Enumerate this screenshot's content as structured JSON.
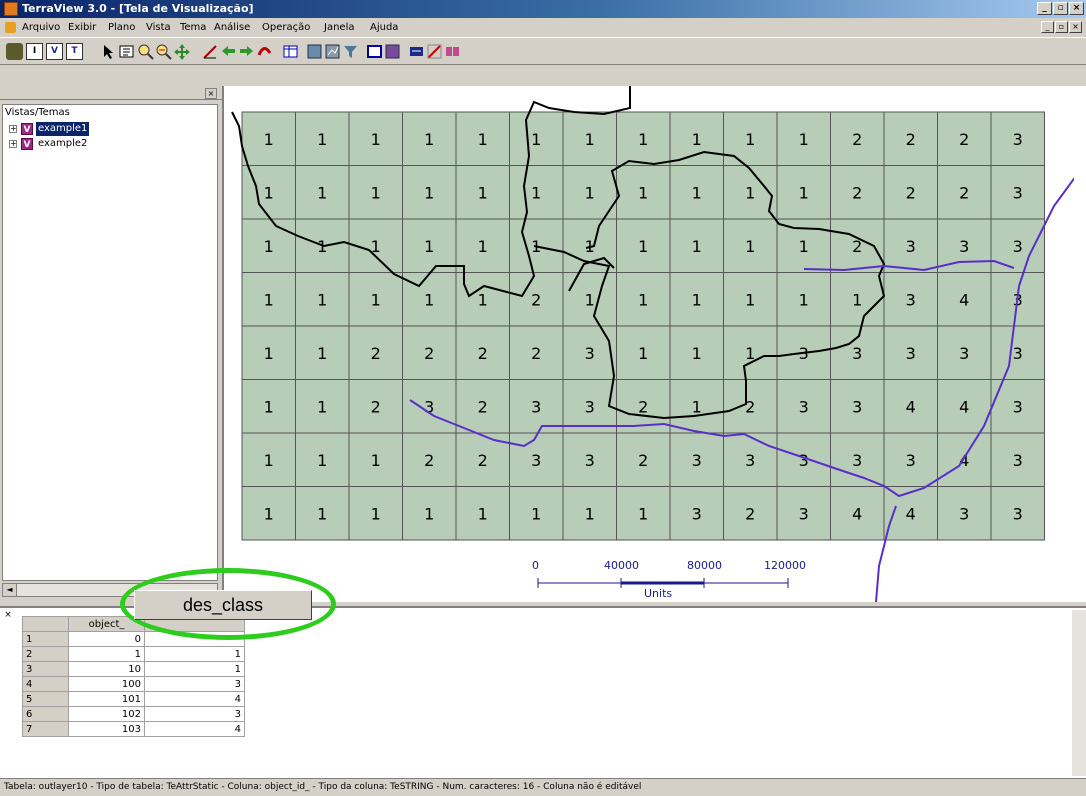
{
  "window": {
    "title": "TerraView 3.0 - [Tela de Visualização]",
    "min": "_",
    "max": "▫",
    "close": "×"
  },
  "menu": {
    "items": [
      "Arquivo",
      "Exibir",
      "Plano",
      "Vista",
      "Tema",
      "Análise",
      "Operação",
      "Janela",
      "Ajuda"
    ]
  },
  "toolbar": {
    "icons": [
      "database-icon",
      "I-layer-icon",
      "V-view-icon",
      "T-theme-icon",
      "pointer-icon",
      "info-icon",
      "zoom-in-icon",
      "zoom-out-icon",
      "pan-icon",
      "edit-icon",
      "back-icon",
      "forward-icon",
      "recompose-icon",
      "table-icon",
      "query-icon",
      "graph-icon",
      "filter-icon",
      "layout-icon",
      "print-icon",
      "legend-icon",
      "chart-icon",
      "export-icon"
    ],
    "letters": [
      "I",
      "V",
      "T"
    ]
  },
  "left_panel": {
    "close": "×",
    "tree_root": "Vistas/Temas",
    "items": [
      {
        "label": "example1",
        "badge": "V",
        "selected": true
      },
      {
        "label": "example2",
        "badge": "V",
        "selected": false
      }
    ],
    "scroll_left": "◄"
  },
  "map": {
    "rows": [
      [
        1,
        1,
        1,
        1,
        1,
        1,
        1,
        1,
        1,
        1,
        1,
        2,
        2,
        2,
        3
      ],
      [
        1,
        1,
        1,
        1,
        1,
        1,
        1,
        1,
        1,
        1,
        1,
        2,
        2,
        2,
        3
      ],
      [
        1,
        1,
        1,
        1,
        1,
        1,
        1,
        1,
        1,
        1,
        1,
        2,
        3,
        3,
        3
      ],
      [
        1,
        1,
        1,
        1,
        1,
        2,
        1,
        1,
        1,
        1,
        1,
        1,
        3,
        4,
        3
      ],
      [
        1,
        1,
        2,
        2,
        2,
        2,
        3,
        1,
        1,
        1,
        3,
        3,
        3,
        3,
        3
      ],
      [
        1,
        1,
        2,
        3,
        2,
        3,
        3,
        2,
        1,
        2,
        3,
        3,
        4,
        4,
        3
      ],
      [
        1,
        1,
        1,
        2,
        2,
        3,
        3,
        2,
        3,
        3,
        3,
        3,
        3,
        4,
        3
      ],
      [
        1,
        1,
        1,
        1,
        1,
        1,
        1,
        1,
        3,
        2,
        3,
        4,
        4,
        3,
        3
      ]
    ],
    "cell_color": "#b7cdb7",
    "boundary_color": "#000000",
    "river_color": "#5a2ec8",
    "scale": {
      "ticks": [
        "0",
        "40000",
        "80000",
        "120000"
      ],
      "units": "Units"
    }
  },
  "callout": {
    "label": "des_class",
    "color": "#2ecc1e"
  },
  "grid": {
    "columns": [
      "",
      "object_",
      ""
    ],
    "rows": [
      {
        "n": "1",
        "object_id": "0",
        "des_class": ""
      },
      {
        "n": "2",
        "object_id": "1",
        "des_class": "1"
      },
      {
        "n": "3",
        "object_id": "10",
        "des_class": "1"
      },
      {
        "n": "4",
        "object_id": "100",
        "des_class": "3"
      },
      {
        "n": "5",
        "object_id": "101",
        "des_class": "4"
      },
      {
        "n": "6",
        "object_id": "102",
        "des_class": "3"
      },
      {
        "n": "7",
        "object_id": "103",
        "des_class": "4"
      }
    ],
    "close": "×"
  },
  "status": "Tabela: outlayer10 - Tipo de tabela: TeAttrStatic - Coluna: object_id_ - Tipo da coluna: TeSTRING - Num. caracteres: 16 - Coluna não é editável"
}
